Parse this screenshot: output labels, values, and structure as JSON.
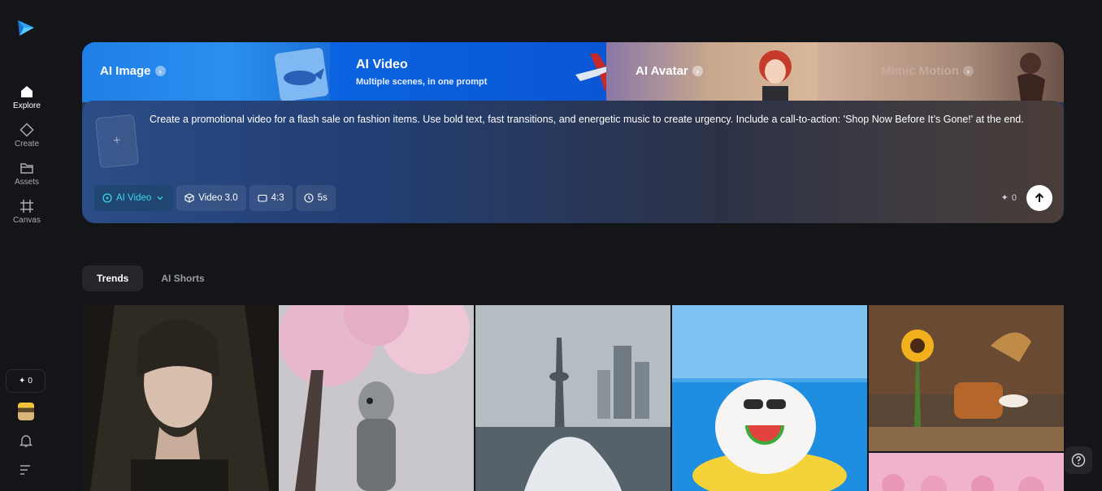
{
  "sidebar": {
    "logo": "app-logo",
    "items": [
      {
        "label": "Explore",
        "icon": "home-icon"
      },
      {
        "label": "Create",
        "icon": "diamond-icon"
      },
      {
        "label": "Assets",
        "icon": "folder-icon"
      },
      {
        "label": "Canvas",
        "icon": "canvas-icon"
      }
    ],
    "credits": "0",
    "bottom_icons": [
      "avatar",
      "bell-icon",
      "menu-icon"
    ]
  },
  "hero": {
    "tabs": [
      {
        "title": "AI Image"
      },
      {
        "title": "AI Video",
        "subtitle": "Multiple scenes, in one prompt"
      },
      {
        "title": "AI Avatar"
      },
      {
        "title": "Mimic Motion"
      }
    ],
    "prompt": "Create a promotional video for a flash sale on fashion items. Use bold text, fast transitions, and energetic music to create urgency. Include a call-to-action: 'Shop Now Before It’s Gone!' at the end.",
    "upload_symbol": "+",
    "controls": {
      "mode": "AI Video",
      "model": "Video 3.0",
      "ratio": "4:3",
      "duration": "5s"
    },
    "cost": "0"
  },
  "feed": {
    "tabs": [
      "Trends",
      "AI Shorts"
    ]
  },
  "colors": {
    "accent": "#3fd4e8",
    "background": "#141518",
    "video_tab": "#0a56d6"
  }
}
